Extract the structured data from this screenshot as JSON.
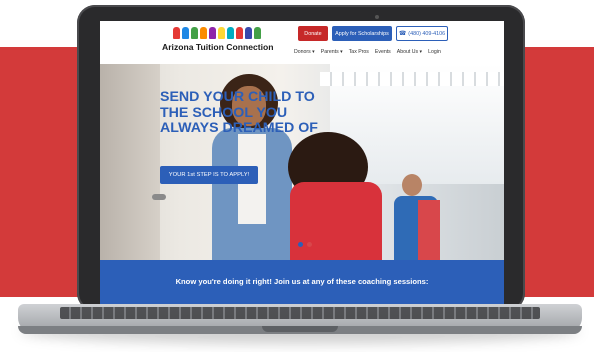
{
  "header": {
    "logo_text": "Arizona Tuition Connection",
    "buttons": {
      "donate": "Donate",
      "apply": "Apply for Scholarships",
      "phone": "(480) 409-4106"
    },
    "nav": [
      "Donors ▾",
      "Parents ▾",
      "Tax Pros",
      "Events",
      "About Us ▾",
      "Login"
    ]
  },
  "hero": {
    "title": "SEND YOUR CHILD TO THE SCHOOL YOU ALWAYS DREAMED OF",
    "cta": "YOUR 1st STEP IS TO APPLY!",
    "slides": [
      {
        "active": true
      },
      {
        "active": false
      }
    ]
  },
  "banner": {
    "text": "Know you're doing it right! Join us at any of these coaching sessions:"
  },
  "colors": {
    "brand_blue": "#2c5fb8",
    "brand_red": "#d33a3a",
    "donate_red": "#c62828"
  },
  "icons": {
    "phone": "phone-icon",
    "logo": "children-logo-icon"
  }
}
